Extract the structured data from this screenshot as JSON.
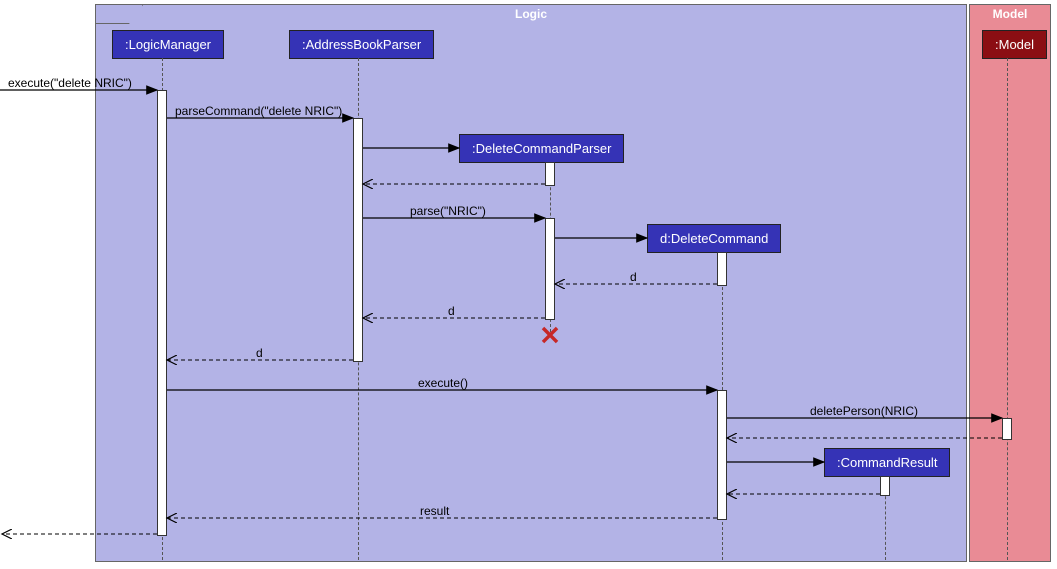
{
  "frames": {
    "logic": {
      "label": "Logic"
    },
    "model": {
      "label": "Model"
    }
  },
  "participants": {
    "logicManager": ":LogicManager",
    "addressBookParser": ":AddressBookParser",
    "deleteCommandParser": ":DeleteCommandParser",
    "deleteCommand": "d:DeleteCommand",
    "commandResult": ":CommandResult",
    "model": ":Model"
  },
  "messages": {
    "execute_in": "execute(\"delete NRIC\")",
    "parseCommand": "parseCommand(\"delete NRIC\")",
    "parse": "parse(\"NRIC\")",
    "return_d1": "d",
    "return_d2": "d",
    "return_d3": "d",
    "execute": "execute()",
    "deletePerson": "deletePerson(NRIC)",
    "result": "result"
  },
  "chart_data": {
    "type": "sequence-diagram",
    "frames": [
      {
        "name": "Logic",
        "contains": [
          ":LogicManager",
          ":AddressBookParser",
          ":DeleteCommandParser",
          "d:DeleteCommand",
          ":CommandResult"
        ]
      },
      {
        "name": "Model",
        "contains": [
          ":Model"
        ]
      }
    ],
    "participants": [
      {
        "id": "ext",
        "name": "(external caller)"
      },
      {
        "id": "lm",
        "name": ":LogicManager"
      },
      {
        "id": "abp",
        "name": ":AddressBookParser"
      },
      {
        "id": "dcp",
        "name": ":DeleteCommandParser",
        "created_by": "abp"
      },
      {
        "id": "dc",
        "name": "d:DeleteCommand",
        "created_by": "dcp"
      },
      {
        "id": "cr",
        "name": ":CommandResult",
        "created_by": "dc"
      },
      {
        "id": "model",
        "name": ":Model"
      }
    ],
    "messages": [
      {
        "from": "ext",
        "to": "lm",
        "label": "execute(\"delete NRIC\")",
        "type": "call"
      },
      {
        "from": "lm",
        "to": "abp",
        "label": "parseCommand(\"delete NRIC\")",
        "type": "call"
      },
      {
        "from": "abp",
        "to": "dcp",
        "label": "",
        "type": "create"
      },
      {
        "from": "dcp",
        "to": "abp",
        "label": "",
        "type": "return"
      },
      {
        "from": "abp",
        "to": "dcp",
        "label": "parse(\"NRIC\")",
        "type": "call"
      },
      {
        "from": "dcp",
        "to": "dc",
        "label": "",
        "type": "create"
      },
      {
        "from": "dc",
        "to": "dcp",
        "label": "d",
        "type": "return"
      },
      {
        "from": "dcp",
        "to": "abp",
        "label": "d",
        "type": "return"
      },
      {
        "note": "dcp destroyed",
        "type": "destroy",
        "target": "dcp"
      },
      {
        "from": "abp",
        "to": "lm",
        "label": "d",
        "type": "return"
      },
      {
        "from": "lm",
        "to": "dc",
        "label": "execute()",
        "type": "call"
      },
      {
        "from": "dc",
        "to": "model",
        "label": "deletePerson(NRIC)",
        "type": "call"
      },
      {
        "from": "model",
        "to": "dc",
        "label": "",
        "type": "return"
      },
      {
        "from": "dc",
        "to": "cr",
        "label": "",
        "type": "create"
      },
      {
        "from": "cr",
        "to": "dc",
        "label": "",
        "type": "return"
      },
      {
        "from": "dc",
        "to": "lm",
        "label": "result",
        "type": "return"
      },
      {
        "from": "lm",
        "to": "ext",
        "label": "",
        "type": "return"
      }
    ]
  }
}
